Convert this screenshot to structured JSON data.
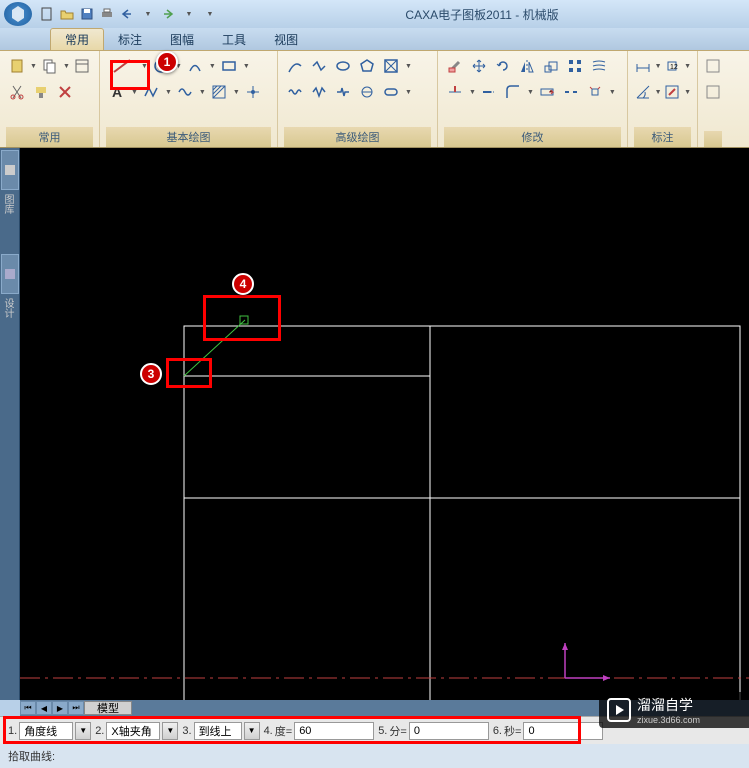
{
  "title": "CAXA电子图板2011 - 机械版",
  "menu": {
    "items": [
      "常用",
      "标注",
      "图幅",
      "工具",
      "视图"
    ],
    "active": "常用"
  },
  "ribbon_groups": {
    "g1": "常用",
    "g2": "基本绘图",
    "g3": "高级绘图",
    "g4": "修改",
    "g5": "标注"
  },
  "tabs": {
    "model": "模型"
  },
  "inputs": {
    "n1": "1.",
    "f1_val": "角度线",
    "n2": "2.",
    "f2_val": "X轴夹角",
    "n3": "3.",
    "f3_val": "到线上",
    "n4": "4.",
    "f4_label": "度=",
    "f4_val": "60",
    "n5": "5.",
    "f5_label": "分=",
    "f5_val": "0",
    "n6": "6.",
    "f6_label": "秒=",
    "f6_val": "0"
  },
  "status": {
    "prompt": "拾取曲线:"
  },
  "markers": {
    "m1": "1",
    "m3": "3",
    "m4": "4"
  },
  "watermark": {
    "brand": "溜溜自学",
    "url": "zixue.3d66.com"
  }
}
